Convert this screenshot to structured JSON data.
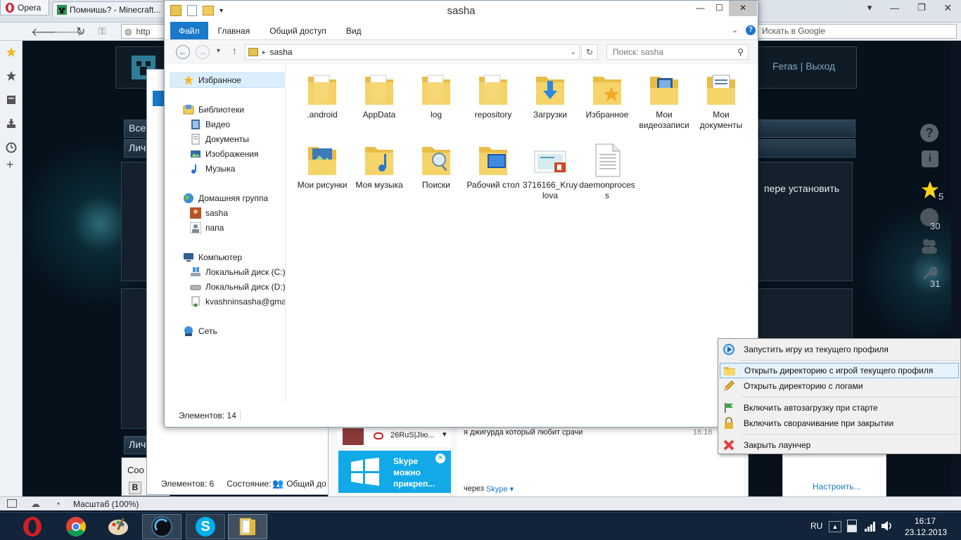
{
  "browser": {
    "app_menu": "Opera",
    "tabs": [
      {
        "title": "Помнишь? - Minecraft..."
      }
    ],
    "address_prefix": "http",
    "search_placeholder": "Искать в Google",
    "zoom_status": "Масштаб (100%)"
  },
  "website": {
    "user_links": "Feras | Выход",
    "bar_all": "Все",
    "bar_personal": "Лич",
    "bar_personal2": "Лич",
    "content_text": "пере установить",
    "bottom_text": "Соо",
    "bottom_bold": "B",
    "stats": [
      {
        "value": "5"
      },
      {
        "value": "30"
      },
      {
        "value": "31"
      }
    ]
  },
  "back_window": {
    "status_items": "Элементов: 6",
    "status_state_label": "Состояние:",
    "status_state_value": "Общий до"
  },
  "explorer": {
    "title": "sasha",
    "ribbon_tabs": [
      "Файл",
      "Главная",
      "Общий доступ",
      "Вид"
    ],
    "address_path": "sasha",
    "search_placeholder": "Поиск: sasha",
    "nav": {
      "favorites": "Избранное",
      "libraries": "Библиотеки",
      "video": "Видео",
      "documents": "Документы",
      "images": "Изображения",
      "music": "Музыка",
      "homegroup": "Домашняя группа",
      "user_sasha": "sasha",
      "user_papa": "папа",
      "computer": "Компьютер",
      "disk_c": "Локальный диск (C:)",
      "disk_d": "Локальный диск (D:)",
      "gmail": "kvashninsasha@gma",
      "network": "Сеть"
    },
    "items": [
      {
        "name": ".android",
        "icon": "folder-icon"
      },
      {
        "name": "AppData",
        "icon": "folder-icon"
      },
      {
        "name": "log",
        "icon": "folder-icon"
      },
      {
        "name": "repository",
        "icon": "folder-icon"
      },
      {
        "name": "Загрузки",
        "icon": "downloads-folder-icon"
      },
      {
        "name": "Избранное",
        "icon": "favorites-folder-icon"
      },
      {
        "name": "Мои видеозаписи",
        "icon": "videos-folder-icon"
      },
      {
        "name": "Мои документы",
        "icon": "documents-folder-icon"
      },
      {
        "name": "Мои рисунки",
        "icon": "pictures-folder-icon"
      },
      {
        "name": "Моя музыка",
        "icon": "music-folder-icon"
      },
      {
        "name": "Поиски",
        "icon": "searches-folder-icon"
      },
      {
        "name": "Рабочий стол",
        "icon": "desktop-folder-icon"
      },
      {
        "name": "3716166_Kruylova",
        "icon": "powerpoint-file-icon"
      },
      {
        "name": "daemonprocess",
        "icon": "text-file-icon"
      }
    ],
    "status_count": "Элементов: 14"
  },
  "skype": {
    "contact_name": "26RuS|JIю...",
    "message": "я джигурда который любит срачи",
    "message_time": "16:16",
    "ad_title": "Skype",
    "ad_text_1": "можно",
    "ad_text_2": "прикреп...",
    "via_label": "через",
    "via_link": "Skype",
    "settings_link": "Настроить..."
  },
  "context_menu": {
    "items": [
      {
        "label": "Запустить игру из текущего профиля",
        "icon": "play-icon"
      },
      {
        "label": "Открыть директорию с игрой текущего профиля",
        "icon": "folder-icon"
      },
      {
        "label": "Открыть директорию с логами",
        "icon": "pencil-icon"
      },
      {
        "label": "Включить автозагрузку при старте",
        "icon": "flag-icon"
      },
      {
        "label": "Включить сворачивание при закрытии",
        "icon": "lock-icon"
      },
      {
        "label": "Закрыть лаунчер",
        "icon": "close-icon"
      }
    ]
  },
  "taskbar": {
    "language": "RU",
    "time": "16:17",
    "date": "23.12.2013"
  },
  "colors": {
    "accent_blue": "#1979ca",
    "folder_yellow": "#f2cd5c",
    "taskbar": "#11243a"
  }
}
